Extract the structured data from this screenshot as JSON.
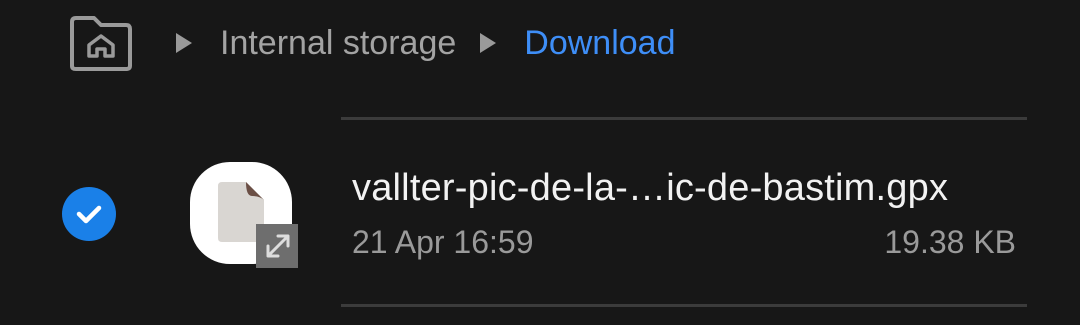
{
  "breadcrumb": {
    "home_icon": "home-folder-icon",
    "separator_icon": "triangle-right-icon",
    "items": [
      {
        "label": "Internal storage",
        "active": false
      },
      {
        "label": "Download",
        "active": true
      }
    ]
  },
  "file": {
    "name": "vallter-pic-de-la-…ic-de-bastim.gpx",
    "date": "21 Apr 16:59",
    "size": "19.38 KB",
    "selected": true,
    "icon": "document-icon",
    "badge_icon": "expand-arrows-icon"
  },
  "colors": {
    "background": "#171717",
    "accent": "#3e8ef7",
    "check": "#1a80e8",
    "divider": "#3b3b3b",
    "primary_text": "#f2f2f2",
    "secondary_text": "#9a9a9a"
  }
}
